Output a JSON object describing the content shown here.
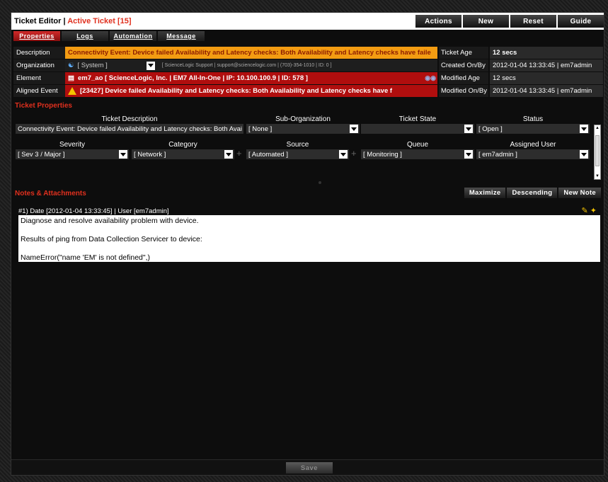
{
  "window": {
    "title": "Ticket Editor",
    "separator": "|",
    "active_label": "Active Ticket [15]"
  },
  "header_actions": [
    "Actions",
    "New",
    "Reset",
    "Guide"
  ],
  "tabs": [
    {
      "label": "Properties",
      "selected": true
    },
    {
      "label": "Logs",
      "selected": false
    },
    {
      "label": "Automation",
      "selected": false
    },
    {
      "label": "Message",
      "selected": false
    }
  ],
  "info": {
    "description_label": "Description",
    "description": "Connectivity Event: Device failed Availability and Latency checks: Both Availability and Latency checks have faile",
    "organization_label": "Organization",
    "organization": "[ System ]",
    "organization_detail": "[ ScienceLogic Support | support@sciencelogic.com | (703)-354-1010 | ID: 0 ]",
    "element_label": "Element",
    "element": "em7_ao [ ScienceLogic, Inc. | EM7 All-In-One | IP: 10.100.100.9 | ID: 578 ]",
    "aligned_label": "Aligned Event",
    "aligned_event": "[23427] Device failed Availability and Latency checks: Both Availability and Latency checks have f",
    "ticket_age_label": "Ticket Age",
    "ticket_age": "12 secs",
    "created_label": "Created On/By",
    "created": "2012-01-04 13:33:45 | em7admin",
    "modified_age_label": "Modified Age",
    "modified_age": "12 secs",
    "modified_label": "Modified On/By",
    "modified": "2012-01-04 13:33:45 | em7admin"
  },
  "ticket_properties": {
    "heading": "Ticket Properties",
    "ticket_description_label": "Ticket Description",
    "ticket_description": "Connectivity Event: Device failed Availability and Latency checks: Both Avai",
    "sub_org_label": "Sub-Organization",
    "sub_org": "[ None ]",
    "state_label": "Ticket State",
    "state": "",
    "status_label": "Status",
    "status": "[ Open ]",
    "severity_label": "Severity",
    "severity": "[ Sev 3 / Major ]",
    "category_label": "Category",
    "category": "[ Network ]",
    "source_label": "Source",
    "source": "[ Automated ]",
    "queue_label": "Queue",
    "queue": "[ Monitoring ]",
    "assigned_label": "Assigned User",
    "assigned": "[ em7admin ]"
  },
  "notes": {
    "heading": "Notes & Attachments",
    "buttons": [
      "Maximize",
      "Descending",
      "New Note"
    ],
    "entry_header": "#1) Date [2012-01-04 13:33:45] | User [em7admin]",
    "lines": [
      "Diagnose and resolve availability problem with device.",
      "",
      "Results of ping from Data Collection Servicer to device:",
      "",
      "NameError(\"name 'EM' is not defined\",)"
    ]
  },
  "footer": {
    "save_label": "Save"
  },
  "colors": {
    "accent_red": "#b00e0e",
    "accent_orange": "#f39c12",
    "heading_red": "#e0301e"
  }
}
